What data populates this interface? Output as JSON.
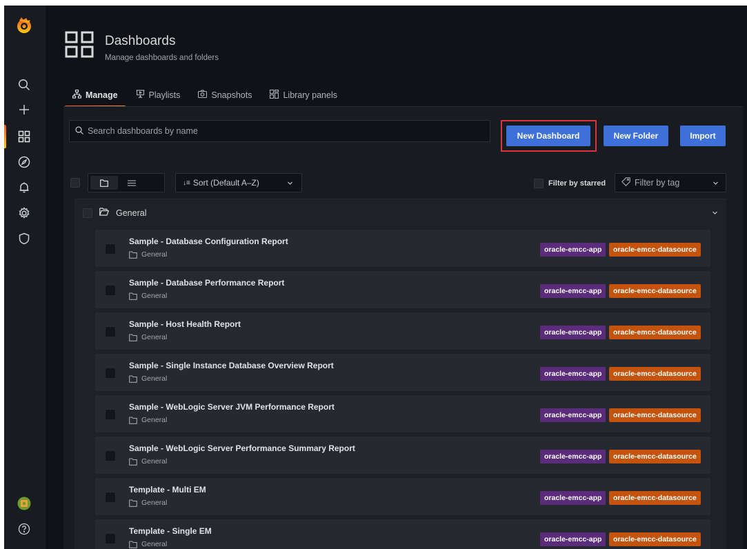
{
  "sidebar": {
    "icons": [
      "grafana-logo-icon",
      "search-icon",
      "plus-icon",
      "dashboards-icon",
      "explore-icon",
      "alerting-icon",
      "settings-icon",
      "shield-icon",
      "user-avatar-icon",
      "help-icon"
    ]
  },
  "header": {
    "title": "Dashboards",
    "subtitle": "Manage dashboards and folders"
  },
  "tabs": [
    {
      "label": "Manage",
      "icon": "sitemap-icon",
      "active": true
    },
    {
      "label": "Playlists",
      "icon": "presentation-icon",
      "active": false
    },
    {
      "label": "Snapshots",
      "icon": "camera-icon",
      "active": false
    },
    {
      "label": "Library panels",
      "icon": "library-panel-icon",
      "active": false
    }
  ],
  "search": {
    "placeholder": "Search dashboards by name"
  },
  "actions": {
    "new_dashboard": "New Dashboard",
    "new_folder": "New Folder",
    "import": "Import"
  },
  "filters": {
    "sort": "Sort (Default A–Z)",
    "starred": "Filter by starred",
    "tag": "Filter by tag"
  },
  "folder": {
    "name": "General",
    "rows": [
      {
        "title": "Sample - Database Configuration Report",
        "folder": "General",
        "tags": [
          "oracle-emcc-app",
          "oracle-emcc-datasource"
        ]
      },
      {
        "title": "Sample - Database Performance Report",
        "folder": "General",
        "tags": [
          "oracle-emcc-app",
          "oracle-emcc-datasource"
        ]
      },
      {
        "title": "Sample - Host Health Report",
        "folder": "General",
        "tags": [
          "oracle-emcc-app",
          "oracle-emcc-datasource"
        ]
      },
      {
        "title": "Sample - Single Instance Database Overview Report",
        "folder": "General",
        "tags": [
          "oracle-emcc-app",
          "oracle-emcc-datasource"
        ]
      },
      {
        "title": "Sample - WebLogic Server JVM Performance Report",
        "folder": "General",
        "tags": [
          "oracle-emcc-app",
          "oracle-emcc-datasource"
        ]
      },
      {
        "title": "Sample - WebLogic Server Performance Summary Report",
        "folder": "General",
        "tags": [
          "oracle-emcc-app",
          "oracle-emcc-datasource"
        ]
      },
      {
        "title": "Template - Multi EM",
        "folder": "General",
        "tags": [
          "oracle-emcc-app",
          "oracle-emcc-datasource"
        ]
      },
      {
        "title": "Template - Single EM",
        "folder": "General",
        "tags": [
          "oracle-emcc-app",
          "oracle-emcc-datasource"
        ]
      }
    ]
  },
  "colors": {
    "primary": "#3d71d9",
    "tag_app": "#5b2b7c",
    "tag_datasource": "#c4540d",
    "highlight": "#e0323b"
  }
}
